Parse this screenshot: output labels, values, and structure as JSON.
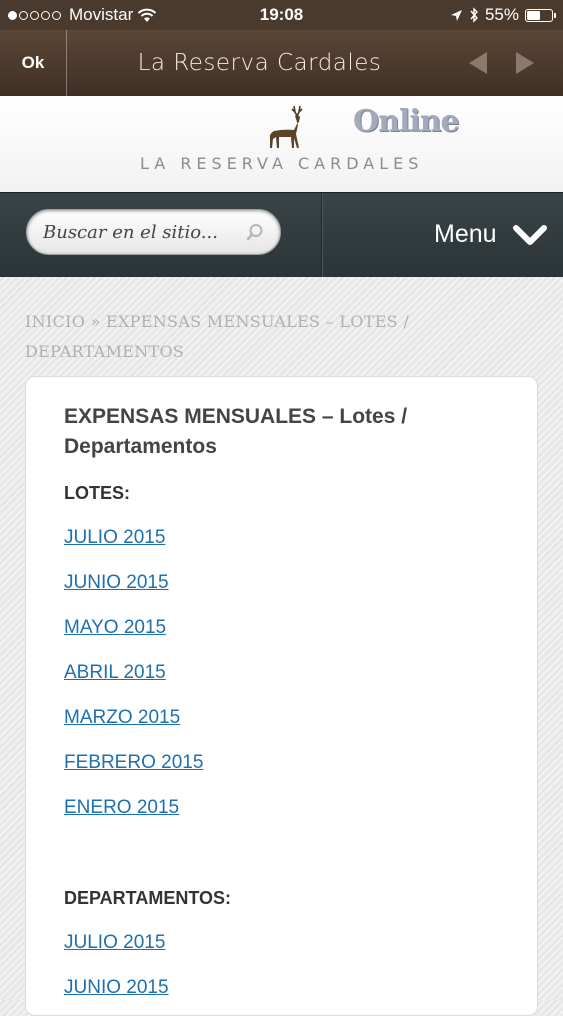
{
  "status_bar": {
    "carrier": "Movistar",
    "time": "19:08",
    "battery_pct": "55%",
    "battery_level": 0.55,
    "signal_bars": 1
  },
  "title_bar": {
    "ok_label": "Ok",
    "title": "La Reserva Cardales",
    "back_icon": "arrow-left-icon",
    "forward_icon": "arrow-right-icon"
  },
  "logo": {
    "online": "Online",
    "brand": "LA RESERVA CARDALES"
  },
  "search": {
    "placeholder": "Buscar en el sitio..."
  },
  "menu": {
    "label": "Menu"
  },
  "breadcrumb": {
    "home": "INICIO",
    "separator": "»",
    "current": "EXPENSAS MENSUALES – LOTES / DEPARTAMENTOS"
  },
  "content": {
    "title": "EXPENSAS MENSUALES – Lotes / Departamentos",
    "lotes_title": "LOTES:",
    "lotes": [
      "JULIO 2015",
      "JUNIO 2015",
      "MAYO 2015",
      "ABRIL 2015",
      "MARZO 2015",
      "FEBRERO 2015",
      "ENERO 2015"
    ],
    "departamentos_title": "DEPARTAMENTOS:",
    "departamentos": [
      "JULIO 2015",
      "JUNIO 2015"
    ]
  },
  "colors": {
    "link": "#1e6fb0",
    "header_brown": "#4a3a2e",
    "nav_dark": "#2f393b"
  }
}
